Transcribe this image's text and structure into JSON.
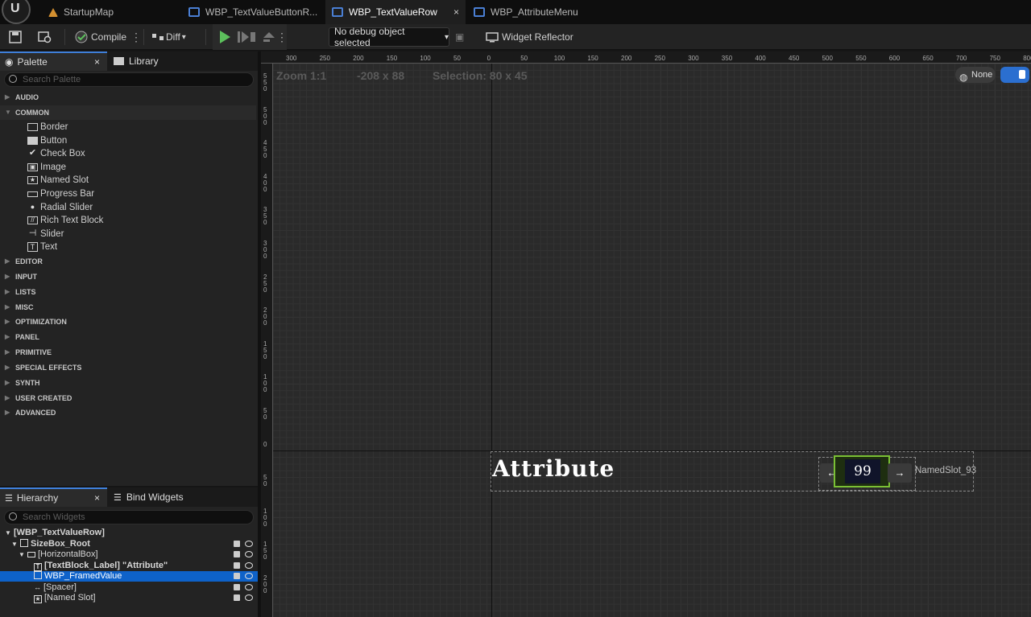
{
  "tabs": [
    {
      "label": "StartupMap",
      "icon": "map-icon"
    },
    {
      "label": "WBP_TextValueButtonR...",
      "icon": "widget-blueprint-icon"
    },
    {
      "label": "WBP_TextValueRow",
      "icon": "widget-blueprint-icon",
      "active": true,
      "close": "×"
    },
    {
      "label": "WBP_AttributeMenu",
      "icon": "widget-blueprint-icon"
    }
  ],
  "toolbar": {
    "compile": "Compile",
    "diff": "Diff",
    "debug": "No debug object selected",
    "reflector": "Widget Reflector"
  },
  "palette": {
    "tab": "Palette",
    "close": "×",
    "library": "Library",
    "search_placeholder": "Search Palette",
    "categories_top": [
      "AUDIO",
      "COMMON"
    ],
    "common_items": [
      {
        "label": "Border",
        "icon": "border-icon"
      },
      {
        "label": "Button",
        "icon": "button-icon"
      },
      {
        "label": "Check Box",
        "icon": "checkbox-icon"
      },
      {
        "label": "Image",
        "icon": "image-icon"
      },
      {
        "label": "Named Slot",
        "icon": "named-slot-icon"
      },
      {
        "label": "Progress Bar",
        "icon": "progress-bar-icon"
      },
      {
        "label": "Radial Slider",
        "icon": "radial-slider-icon"
      },
      {
        "label": "Rich Text Block",
        "icon": "rich-text-icon"
      },
      {
        "label": "Slider",
        "icon": "slider-icon"
      },
      {
        "label": "Text",
        "icon": "text-icon"
      }
    ],
    "categories_rest": [
      "EDITOR",
      "INPUT",
      "LISTS",
      "MISC",
      "OPTIMIZATION",
      "PANEL",
      "PRIMITIVE",
      "SPECIAL EFFECTS",
      "SYNTH",
      "USER CREATED",
      "ADVANCED"
    ]
  },
  "hierarchy": {
    "tab": "Hierarchy",
    "close": "×",
    "bind": "Bind Widgets",
    "search_placeholder": "Search Widgets",
    "rows": [
      "[WBP_TextValueRow]",
      "SizeBox_Root",
      "[HorizontalBox]",
      "[TextBlock_Label] \"Attribute\"",
      "WBP_FramedValue",
      "[Spacer]",
      "[Named Slot]"
    ]
  },
  "canvas": {
    "zoom": "Zoom 1:1",
    "size": "-208 x 88",
    "selection": "Selection: 80 x 45",
    "dpi": "None",
    "label_text": "Attribute",
    "value": "99",
    "left_arrow": "←",
    "right_arrow": "→",
    "named_slot": "NamedSlot_93",
    "ruler_h": [
      "300",
      "250",
      "200",
      "150",
      "100",
      "50",
      "0",
      "50",
      "100",
      "150",
      "200",
      "250",
      "300",
      "350",
      "400",
      "450",
      "500",
      "550",
      "600",
      "650",
      "700",
      "750",
      "800"
    ],
    "ruler_v": [
      "550",
      "500",
      "450",
      "400",
      "350",
      "300",
      "250",
      "200",
      "150",
      "100",
      "50",
      "0",
      "50",
      "100",
      "150",
      "200"
    ]
  }
}
